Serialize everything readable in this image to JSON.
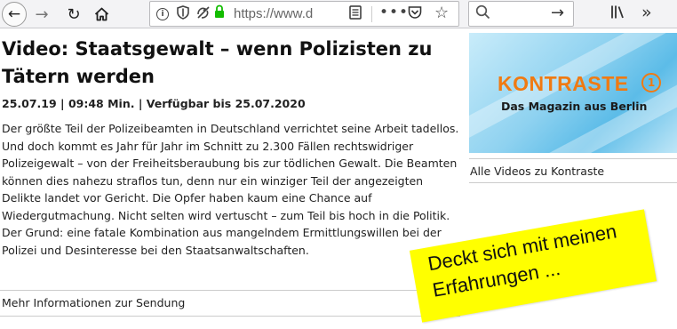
{
  "browser": {
    "url": "https://www.d",
    "icons": {
      "back": "arrow-left",
      "forward": "arrow-right",
      "reload": "reload",
      "home": "home",
      "info": "info",
      "tracking": "shield",
      "permissions": "permissions",
      "lock": "lock",
      "reader": "reader-view",
      "more": "page-actions",
      "pocket": "pocket",
      "bookmark": "star",
      "search": "magnifier",
      "go": "arrow-right",
      "library": "library",
      "overflow": "double-chevron"
    },
    "accent_lock": "#12bc00"
  },
  "article": {
    "title": "Video: Staatsgewalt – wenn Polizisten zu Tätern werden",
    "meta": "25.07.19 | 09:48 Min. | Verfügbar bis 25.07.2020",
    "body": "Der größte Teil der Polizeibeamten in Deutschland verrichtet seine Arbeit tadellos. Und doch kommt es Jahr für Jahr im Schnitt zu 2.300 Fällen rechtswidriger Polizeigewalt – von der Freiheitsberaubung bis zur tödlichen Gewalt. Die Beamten können dies nahezu straflos tun, denn nur ein winziger Teil der angezeigten Delikte landet vor Gericht. Die Opfer haben kaum eine Chance auf Wiedergutmachung. Nicht selten wird vertuscht – zum Teil bis hoch in die Politik. Der Grund: eine fatale Kombination aus mangelndem Ermittlungswillen bei der Polizei und Desinteresse bei den Staatsanwaltschaften.",
    "more_link": "Mehr Informationen zur Sendung"
  },
  "sidebar": {
    "logo": "KONTRASTE",
    "logo_mark": "1",
    "tagline": "Das Magazin aus Berlin",
    "link": "Alle Videos zu Kontraste",
    "logo_color": "#f07a12"
  },
  "note": {
    "text": "Deckt sich mit meinen Erfahrungen ...",
    "color": "#ffff00"
  }
}
